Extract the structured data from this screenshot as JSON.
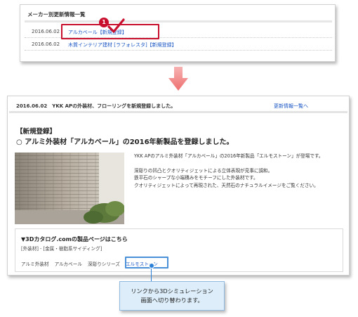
{
  "top_panel": {
    "title": "メーカー別更新情報一覧",
    "rows": [
      {
        "date": "2016.06.02",
        "link": "アルカベール【新規登録】"
      },
      {
        "date": "2016.06.02",
        "link": "木質インテリア建材 [ラフォレスタ]【新規登録】"
      }
    ],
    "step_number": "1"
  },
  "detail_panel": {
    "info_bar": {
      "text": "2016.06.02　YKK APの外装材、フローリングを新規登録しました。",
      "link": "更新情報一覧へ"
    },
    "label": "【新規登録】",
    "headline": "○ アルミ外装材「アルカベール」の2016年新製品を登録しました。",
    "description": [
      "YKK APのアルミ外装材「アルカベール」の2016年新製品「エルモストーン」が登場です。",
      "深彫りの凹凸とクオリティジェットによる立体表現が見事に調和。",
      "鉄平石のシャープな小端積みをモチーフにした外装材です。",
      "クオリティジェットによって再現された、天然石のナチュラルイメージをご覧ください。"
    ],
    "catalog": {
      "title": "▼3Dカタログ.comの製品ページはこちら",
      "category": "[外装材] - [金属・樹脂系サイディング]",
      "path": [
        "アルミ外装材",
        "アルカベール",
        "深彫りシリーズ",
        "エルモストーン"
      ]
    }
  },
  "callout": {
    "line1": "リンクから3Dシミュレーション",
    "line2": "画面へ切り替わります。"
  },
  "colors": {
    "link": "#1a56c4",
    "highlight_red": "#c8102e",
    "focus_blue": "#4a90d9",
    "arrow_pink": "#f28a8a",
    "callout_bg": "#ddeefa"
  }
}
